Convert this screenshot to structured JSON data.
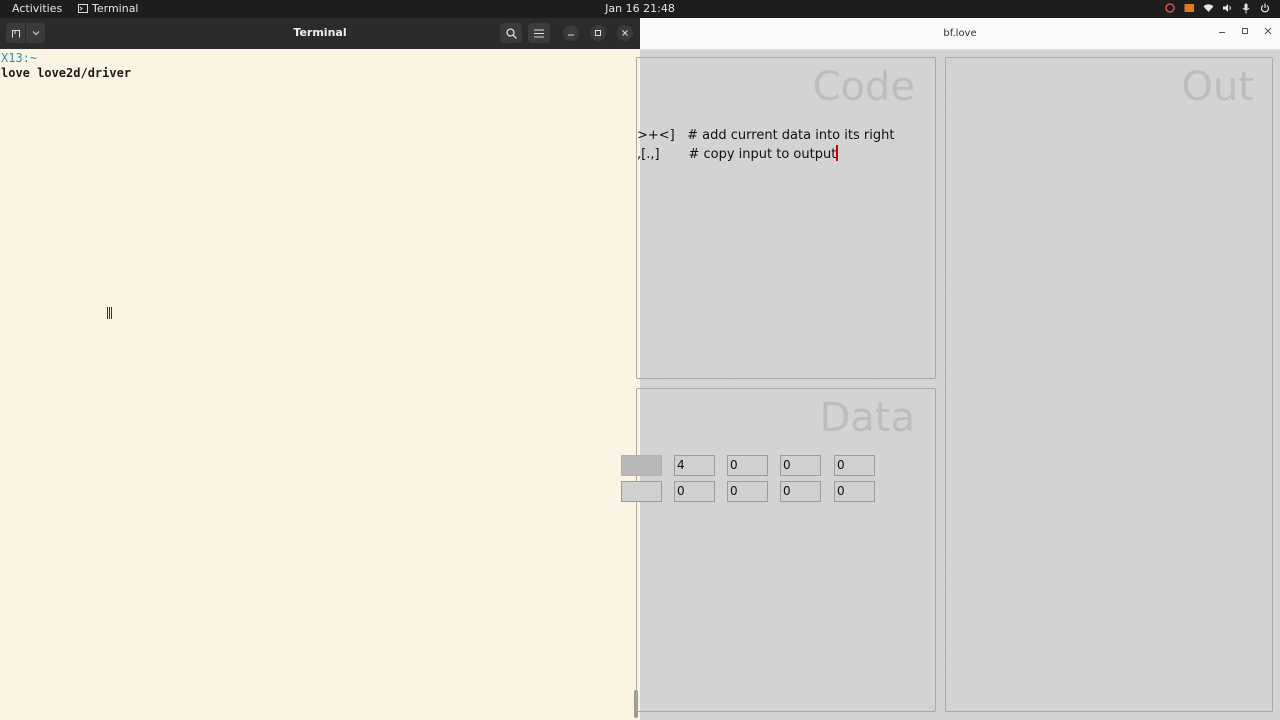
{
  "topbar": {
    "activities": "Activities",
    "app_name": "Terminal",
    "clock": "Jan 16  21:48"
  },
  "terminal": {
    "title": "Terminal",
    "prompt": "X13:~",
    "command": "love love2d/driver"
  },
  "bf": {
    "title": "bf.love",
    "code_title": "Code",
    "out_title": "Out",
    "data_title": "Data",
    "code_lines": [
      ">+<]   # add current data into its right",
      ",[.,]       # copy input to output"
    ],
    "data_rows": [
      [
        "",
        "4",
        "0",
        "0",
        "0"
      ],
      [
        "",
        "0",
        "0",
        "0",
        "0"
      ]
    ]
  },
  "colors": {
    "terminal_bg": "#fbf4e2",
    "prompt": "#2a8fb8",
    "caret": "#d00000",
    "panel_title": "#bdbdbd"
  }
}
